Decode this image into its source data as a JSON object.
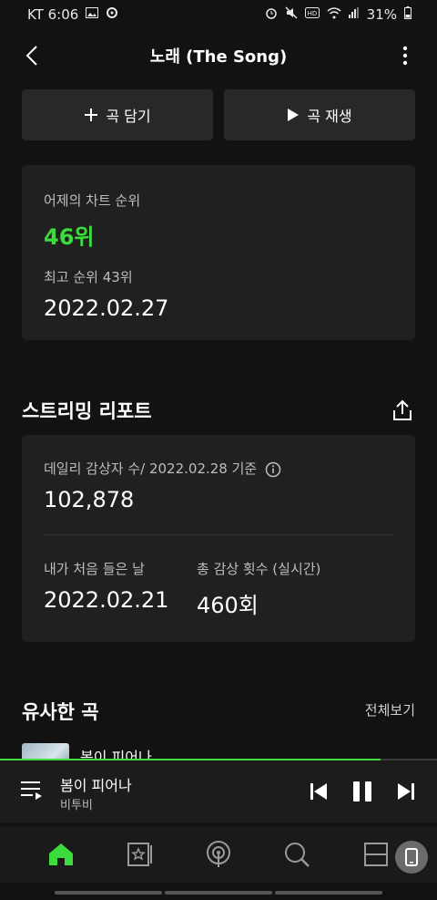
{
  "status": {
    "carrier_time": "KT 6:06",
    "battery": "31%"
  },
  "header": {
    "title": "노래 (The Song)"
  },
  "actions": {
    "add_label": "곡 담기",
    "play_label": "곡 재생"
  },
  "chart": {
    "yesterday_label": "어제의 차트 순위",
    "yesterday_rank": "46위",
    "best_rank": "최고 순위 43위",
    "best_date": "2022.02.27"
  },
  "report": {
    "title": "스트리밍 리포트",
    "daily_label": "데일리 감상자 수/ 2022.02.28 기준",
    "daily_value": "102,878",
    "first_listen_label": "내가 처음 들은 날",
    "first_listen_value": "2022.02.21",
    "total_plays_label": "총 감상 횟수 (실시간)",
    "total_plays_value": "460회"
  },
  "similar": {
    "title": "유사한 곡",
    "view_all": "전체보기",
    "peek_title": "봄이 피어나"
  },
  "player": {
    "title": "봄이 피어나",
    "artist": "비투비",
    "progress": 0.87
  },
  "colors": {
    "accent": "#3ddc3d",
    "background": "#121212",
    "card": "#202020"
  }
}
